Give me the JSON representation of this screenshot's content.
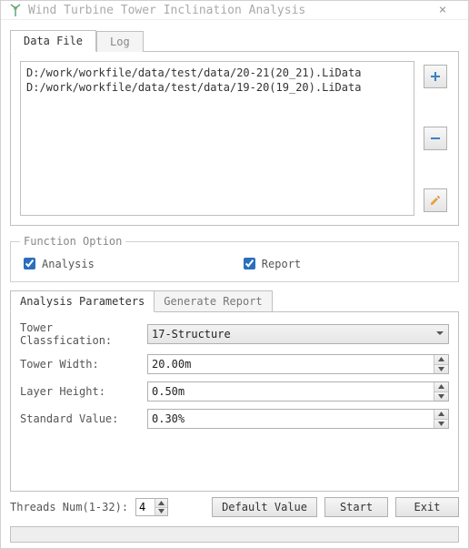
{
  "window": {
    "title": "Wind Turbine Tower Inclination Analysis"
  },
  "tabs": {
    "data_file": "Data File",
    "log": "Log"
  },
  "files": [
    "D:/work/workfile/data/test/data/20-21(20_21).LiData",
    "D:/work/workfile/data/test/data/19-20(19_20).LiData"
  ],
  "function_option": {
    "legend": "Function Option",
    "analysis_label": "Analysis",
    "analysis_checked": true,
    "report_label": "Report",
    "report_checked": true
  },
  "param_tabs": {
    "analysis": "Analysis Parameters",
    "report": "Generate Report"
  },
  "params": {
    "tower_classification_label": "Tower Classfication:",
    "tower_classification_value": "17-Structure",
    "tower_width_label": "Tower Width:",
    "tower_width_value": "20.00m",
    "layer_height_label": "Layer Height:",
    "layer_height_value": "0.50m",
    "standard_value_label": "Standard Value:",
    "standard_value_value": "0.30%"
  },
  "threads": {
    "label": "Threads Num(1-32):",
    "value": "4"
  },
  "buttons": {
    "default": "Default Value",
    "start": "Start",
    "exit": "Exit"
  }
}
